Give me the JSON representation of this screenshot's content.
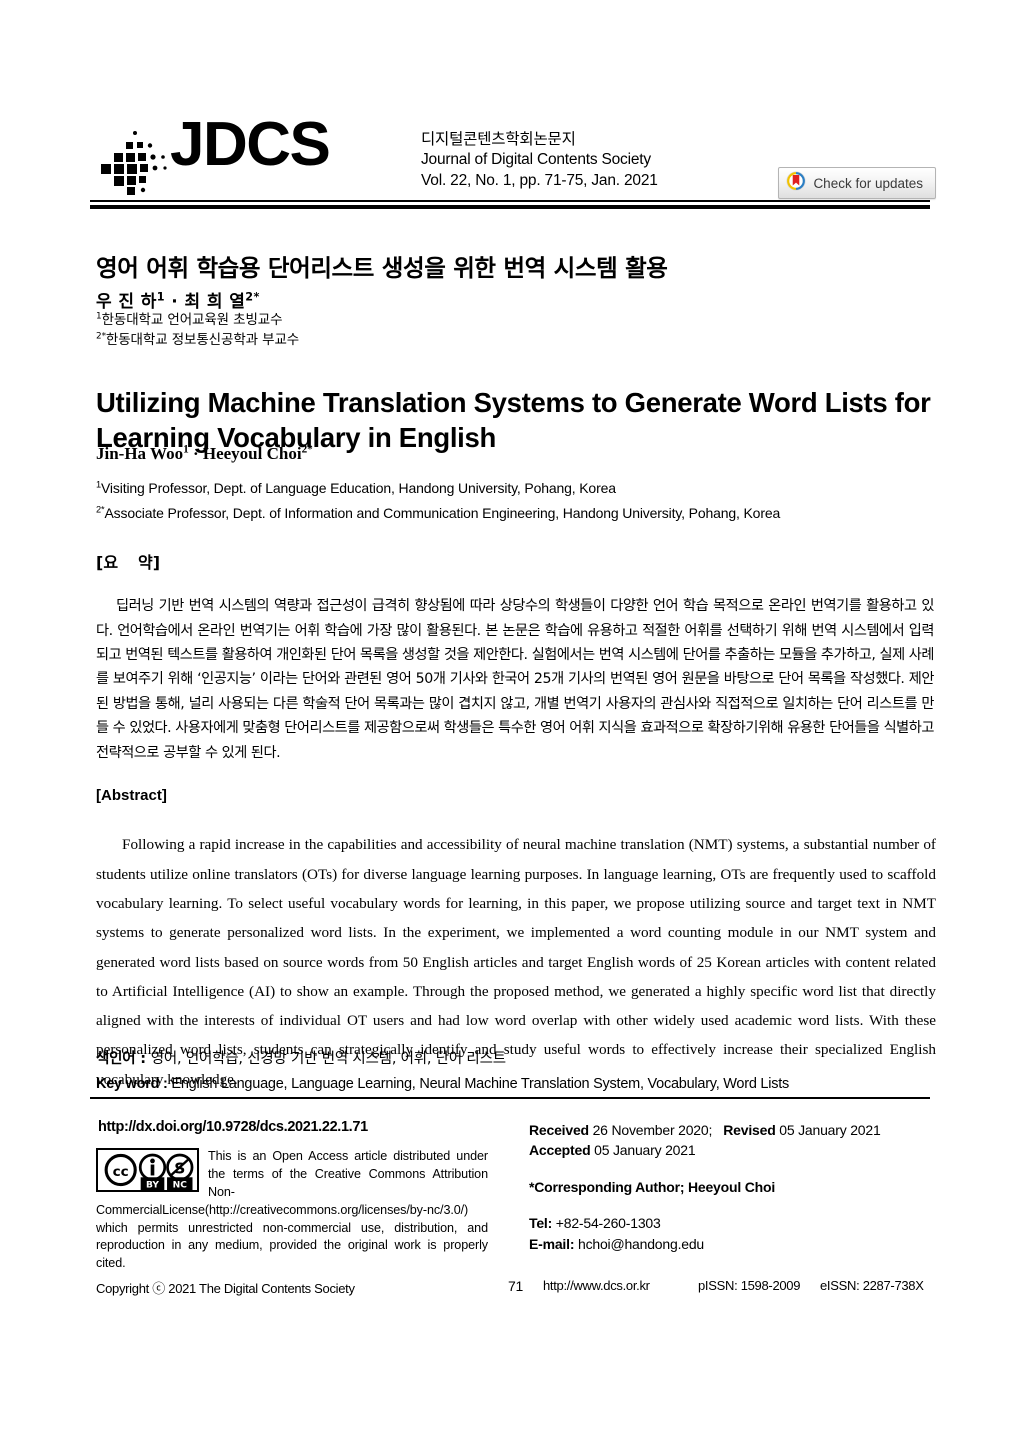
{
  "masthead": {
    "logo_word": "JDCS",
    "logo_icon": "jdcs-diamond-dots-logo",
    "journal_name_ko": "디지털콘텐츠학회논문지",
    "journal_name_en": "Journal of Digital Contents Society",
    "issue_line": "Vol. 22, No. 1, pp. 71-75, Jan. 2021",
    "badge_label": "Check for updates",
    "badge_icon": "crossmark-icon"
  },
  "article": {
    "title_ko": "영어 어휘 학습용 단어리스트 생성을 위한 번역 시스템 활용",
    "authors_ko_1": "우 진 하",
    "authors_ko_1_sup": "1",
    "authors_ko_sep": " · ",
    "authors_ko_2": "최 희 열",
    "authors_ko_2_sup": "2*",
    "affil_ko_1_sup": "1",
    "affil_ko_1": "한동대학교 언어교육원 초빙교수",
    "affil_ko_2_sup": "2*",
    "affil_ko_2": "한동대학교 정보통신공학과 부교수",
    "title_en": "Utilizing Machine Translation Systems to Generate Word Lists for Learning Vocabulary in English",
    "authors_en_1": "Jin-Ha Woo",
    "authors_en_1_sup": "1",
    "authors_en_sep": " · ",
    "authors_en_2": "Heeyoul Choi",
    "authors_en_2_sup": "2*",
    "affil_en_1_sup": "1",
    "affil_en_1": "Visiting Professor, Dept. of Language Education, Handong University, Pohang, Korea",
    "affil_en_2_sup": "2*",
    "affil_en_2": "Associate Professor, Dept. of Information and Communication Engineering, Handong University, Pohang, Korea"
  },
  "abstract_ko": {
    "heading_left": "[요",
    "heading_right": "약]",
    "body": "딥러닝 기반 번역 시스템의 역량과 접근성이 급격히 향상됨에 따라 상당수의 학생들이 다양한 언어 학습 목적으로 온라인 번역기를 활용하고 있다. 언어학습에서 온라인 번역기는 어휘 학습에 가장 많이 활용된다. 본 논문은 학습에 유용하고 적절한 어휘를 선택하기 위해 번역 시스템에서 입력되고 번역된 텍스트를 활용하여 개인화된 단어 목록을 생성할 것을 제안한다. 실험에서는 번역 시스템에 단어를 추출하는 모듈을 추가하고, 실제 사례를 보여주기 위해 ‘인공지능’ 이라는 단어와 관련된 영어 50개 기사와 한국어 25개 기사의 번역된 영어 원문을 바탕으로 단어 목록을 작성했다. 제안된 방법을 통해, 널리 사용되는 다른 학술적 단어 목록과는 많이 겹치지 않고, 개별 번역기 사용자의 관심사와 직접적으로 일치하는 단어 리스트를 만들 수 있었다. 사용자에게 맞춤형 단어리스트를 제공함으로써 학생들은 특수한 영어 어휘 지식을 효과적으로 확장하기위해 유용한 단어들을 식별하고 전략적으로 공부할 수 있게 된다."
  },
  "abstract_en": {
    "heading": "[Abstract]",
    "body": "Following a rapid increase in the capabilities and accessibility of neural machine translation (NMT) systems, a substantial number of students utilize online translators (OTs) for diverse language learning purposes. In language learning, OTs are frequently used to scaffold vocabulary learning. To select useful vocabulary words for learning, in this paper, we propose utilizing source and target text in NMT systems to generate personalized word lists. In the experiment, we implemented a word counting module in our NMT system and generated word lists based on source words from 50 English articles and target English words of 25 Korean articles with content related to Artificial Intelligence (AI) to show an example. Through the proposed method, we generated a highly specific word list that directly aligned with the interests of individual OT users and had low word overlap with other widely used academic word lists. With these personalized word lists, students can strategically identify and study useful words to effectively increase their specialized English vocabulary knowledge."
  },
  "keywords": {
    "ko_label": "색인어 : ",
    "ko_value": "영어, 언어학습,  신경망 기반 번역 시스템, 어휘, 단어 리스트",
    "en_label": "Key word : ",
    "en_value": "English Language, Language Learning, Neural Machine Translation System, Vocabulary, Word Lists"
  },
  "footer": {
    "doi": "http://dx.doi.org/10.9728/dcs.2021.22.1.71",
    "cc_icon": "creative-commons-by-nc-icon",
    "cc_icon_labels": [
      "cc",
      "BY",
      "NC"
    ],
    "license_text": "This is an Open Access article distributed under the terms of the Creative Commons Attribution Non-CommercialLicense(http://creativecommons.org/licenses/by-nc/3.0/) which permits unrestricted non-commercial use, distribution, and reproduction in any medium, provided the original work is properly cited.",
    "received_label": "Received",
    "received_value": "26 November 2020;",
    "revised_label": "Revised",
    "revised_value": "05 January 2021",
    "accepted_label": "Accepted",
    "accepted_value": "05 January 2021",
    "corresponding": "*Corresponding Author; Heeyoul Choi",
    "tel_label": "Tel:",
    "tel_value": "+82-54-260-1303",
    "email_label": "E-mail:",
    "email_value": "hchoi@handong.edu"
  },
  "bottom": {
    "copyright": "Copyright ⓒ 2021 The Digital Contents Society",
    "page_number": "71",
    "site_url": "http://www.dcs.or.kr",
    "pissn": "pISSN: 1598-2009",
    "eissn": "eISSN: 2287-738X"
  }
}
